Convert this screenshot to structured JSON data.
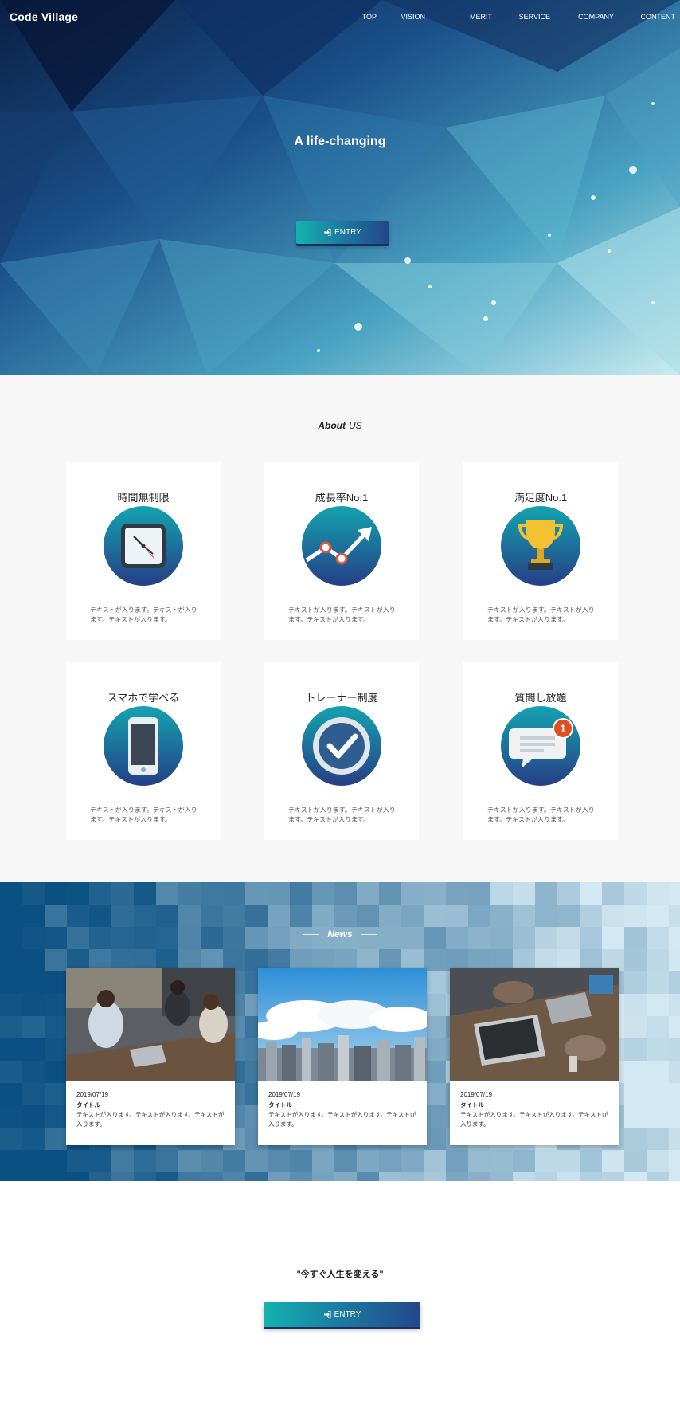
{
  "header": {
    "logo": "Code Village",
    "nav": [
      "TOP",
      "VISION",
      "MERIT",
      "SERVICE",
      "COMPANY",
      "CONTENT"
    ]
  },
  "hero": {
    "title": "A life-changing",
    "entry_label": "ENTRY"
  },
  "about": {
    "heading_strong": "About",
    "heading_light": "US",
    "cards": [
      {
        "title": "時間無制限",
        "icon": "clock-icon",
        "text": "テキストが入ります。テキストが入ります。テキストが入ります。"
      },
      {
        "title": "成長率No.1",
        "icon": "growth-chart-icon",
        "text": "テキストが入ります。テキストが入ります。テキストが入ります。"
      },
      {
        "title": "満足度No.1",
        "icon": "trophy-icon",
        "text": "テキストが入ります。テキストが入ります。テキストが入ります。"
      },
      {
        "title": "スマホで学べる",
        "icon": "smartphone-icon",
        "text": "テキストが入ります。テキストが入ります。テキストが入ります。"
      },
      {
        "title": "トレーナー制度",
        "icon": "checkmark-icon",
        "text": "テキストが入ります。テキストが入ります。テキストが入ります。"
      },
      {
        "title": "質問し放題",
        "icon": "chat-bubble-icon",
        "text": "テキストが入ります。テキストが入ります。テキストが入ります。"
      }
    ]
  },
  "news": {
    "heading": "News",
    "items": [
      {
        "date": "2019/07/19",
        "title": "タイトル",
        "text": "テキストが入ります。テキストが入ります。テキストが入ります。",
        "photo": "meeting-photo"
      },
      {
        "date": "2019/07/19",
        "title": "タイトル",
        "text": "テキストが入ります。テキストが入ります。テキストが入ります。",
        "photo": "city-skyline-photo"
      },
      {
        "date": "2019/07/19",
        "title": "タイトル",
        "text": "テキストが入ります。テキストが入ります。テキストが入ります。",
        "photo": "laptop-desk-photo"
      }
    ]
  },
  "cta": {
    "text": "\"今すぐ人生を変える\"",
    "entry_label": "ENTRY"
  },
  "colors": {
    "accent_start": "#13b3b0",
    "accent_end": "#23468a",
    "icon_circle_top": "#14a3b0",
    "icon_circle_bottom": "#263f86",
    "about_bg": "#f7f7f7"
  }
}
